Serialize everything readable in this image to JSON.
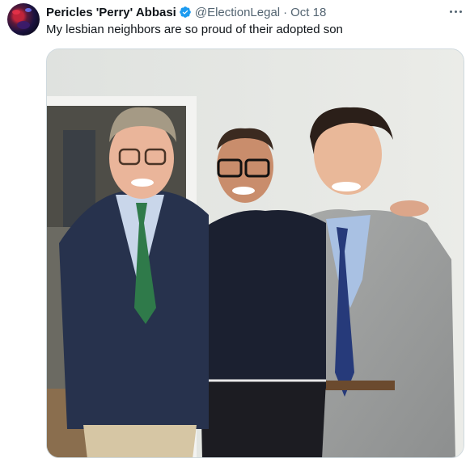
{
  "post": {
    "author_name": "Pericles 'Perry' Abbasi",
    "handle": "@ElectionLegal",
    "separator": "·",
    "timestamp": "Oct 18",
    "text": "My lesbian neighbors are so proud of their adopted son",
    "verified": true
  },
  "icons": {
    "verified": "verified-badge-icon",
    "more": "more-options-icon"
  },
  "colors": {
    "verified_blue": "#1d9bf0",
    "secondary_text": "#536471",
    "primary_text": "#0f1419",
    "border": "#cfd9de"
  }
}
